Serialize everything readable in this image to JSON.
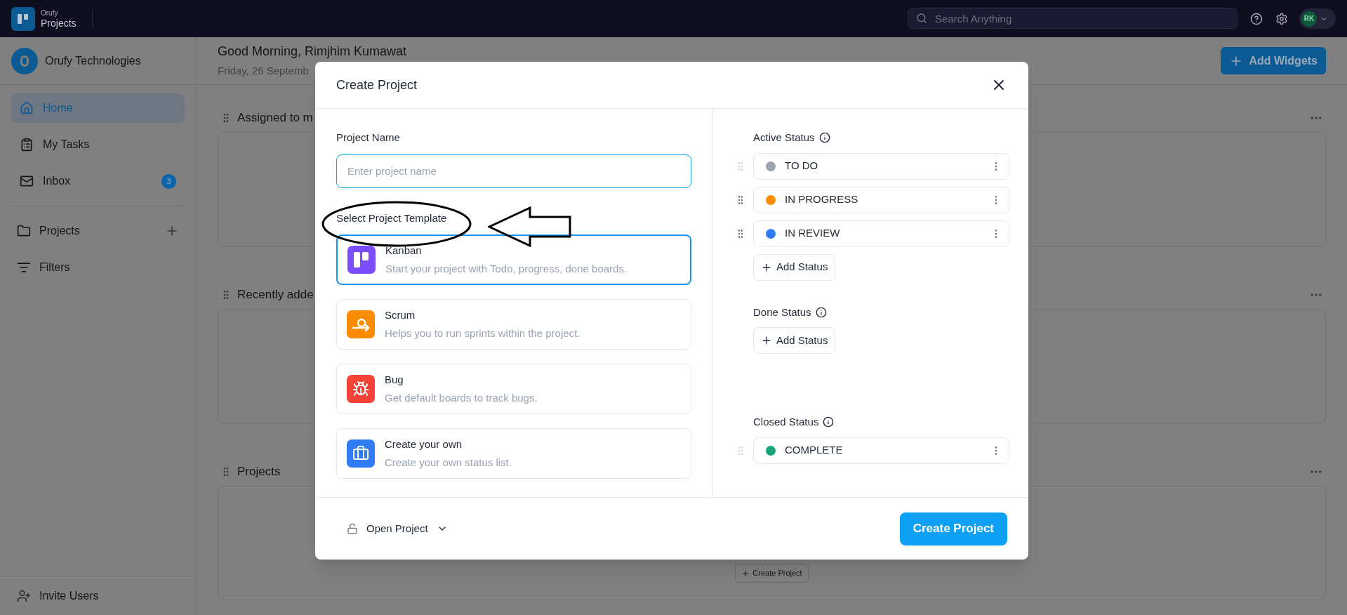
{
  "top_bar": {
    "logo_top": "Orufy",
    "logo_bottom": "Projects",
    "search": {
      "placeholder": "Search Anything"
    },
    "avatar": "RK"
  },
  "sidebar": {
    "org": "Orufy Technologies",
    "nav": [
      {
        "kind": "home",
        "label": "Home",
        "selected": true
      },
      {
        "kind": "tasks",
        "label": "My Tasks",
        "selected": false
      },
      {
        "kind": "inbox",
        "label": "Inbox",
        "selected": false,
        "badge": "3"
      }
    ],
    "sections": [
      {
        "kind": "folder",
        "label": "Projects",
        "addable": true
      },
      {
        "kind": "filter",
        "label": "Filters",
        "addable": false
      }
    ],
    "footer": "Invite Users"
  },
  "main": {
    "greeting": "Good Morning, Rimjhim Kumawat",
    "date": "Friday, 26 Septemb",
    "add_widgets": "Add Widgets",
    "widgets": [
      {
        "title": "Assigned to m"
      },
      {
        "title": "Recently adde"
      },
      {
        "title": "Projects",
        "action": "Create Project"
      }
    ]
  },
  "dialog": {
    "title": "Create Project",
    "name_label": "Project Name",
    "name_field": {
      "placeholder": "Enter project name"
    },
    "template_label": "Select Project Template",
    "templates": [
      {
        "kind": "kanban",
        "name": "Kanban",
        "description": "Start your project with Todo, progress, done boards.",
        "selected": true
      },
      {
        "kind": "scrum",
        "name": "Scrum",
        "description": "Helps you to run sprints within the project.",
        "selected": false
      },
      {
        "kind": "bug",
        "name": "Bug",
        "description": "Get default boards to track bugs.",
        "selected": false
      },
      {
        "kind": "custom",
        "name": "Create your own",
        "description": "Create your own status list.",
        "selected": false
      }
    ],
    "status_groups": [
      {
        "label": "Active Status",
        "statuses": [
          {
            "name": "TO DO",
            "color": "#9ca3af",
            "draggable": false
          },
          {
            "name": "IN PROGRESS",
            "color": "#fb8c00",
            "draggable": true
          },
          {
            "name": "IN REVIEW",
            "color": "#2f7cf6",
            "draggable": true
          }
        ],
        "add_button": "Add Status"
      },
      {
        "label": "Done Status",
        "add_button": "Add Status"
      },
      {
        "label": "Closed Status",
        "statuses": [
          {
            "name": "COMPLETE",
            "color": "#16a37a",
            "draggable": false
          }
        ]
      }
    ],
    "visibility": "Open Project",
    "submit": "Create Project"
  }
}
